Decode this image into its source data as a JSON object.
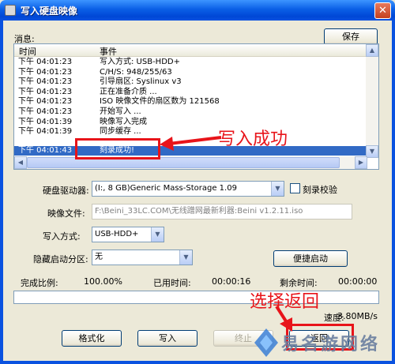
{
  "window": {
    "title": "写入硬盘映像",
    "close_glyph": "✕"
  },
  "messages": {
    "label": "消息:",
    "save_label": "保存",
    "columns": {
      "time": "时间",
      "event": "事件"
    },
    "rows": [
      {
        "time": "下午 04:01:23",
        "event": "写入方式: USB-HDD+"
      },
      {
        "time": "下午 04:01:23",
        "event": "C/H/S: 948/255/63"
      },
      {
        "time": "下午 04:01:23",
        "event": "引导扇区: Syslinux v3"
      },
      {
        "time": "下午 04:01:23",
        "event": "正在准备介质 ..."
      },
      {
        "time": "下午 04:01:23",
        "event": "ISO 映像文件的扇区数为 121568"
      },
      {
        "time": "下午 04:01:23",
        "event": "开始写入 ..."
      },
      {
        "time": "下午 04:01:39",
        "event": "映像写入完成"
      },
      {
        "time": "下午 04:01:39",
        "event": "同步缓存 ..."
      },
      {
        "time": "下午 04:01:43",
        "event": "刻录成功!"
      }
    ]
  },
  "drive": {
    "label": "硬盘驱动器:",
    "value": "(I:, 8 GB)Generic Mass-Storage    1.09",
    "verify_label": "刻录校验"
  },
  "image_file": {
    "label": "映像文件:",
    "value": "F:\\Beini_33LC.COM\\无线蹭网最新利器:Beini v1.2.11.iso"
  },
  "write_mode": {
    "label": "写入方式:",
    "value": "USB-HDD+"
  },
  "hidden_partition": {
    "label": "隐藏启动分区:",
    "value": "无",
    "quick_boot_label": "便捷启动"
  },
  "status": {
    "complete_label": "完成比例:",
    "complete_value": "100.00%",
    "elapsed_label": "已用时间:",
    "elapsed_value": "00:00:16",
    "remaining_label": "剩余时间:",
    "remaining_value": "00:00:00",
    "speed_label": "速度:",
    "speed_value": "3.80MB/s",
    "progress": 1.0
  },
  "buttons": {
    "format": "格式化",
    "write": "写入",
    "terminate": "终止",
    "back": "返回"
  },
  "annotations": {
    "write_success": "写入成功",
    "choose_back": "选择返回"
  },
  "watermark": {
    "text": "易名游网络"
  },
  "colors": {
    "accent": "#e8141a",
    "selection": "#316ac5",
    "titlebar": "#0a52e0"
  }
}
